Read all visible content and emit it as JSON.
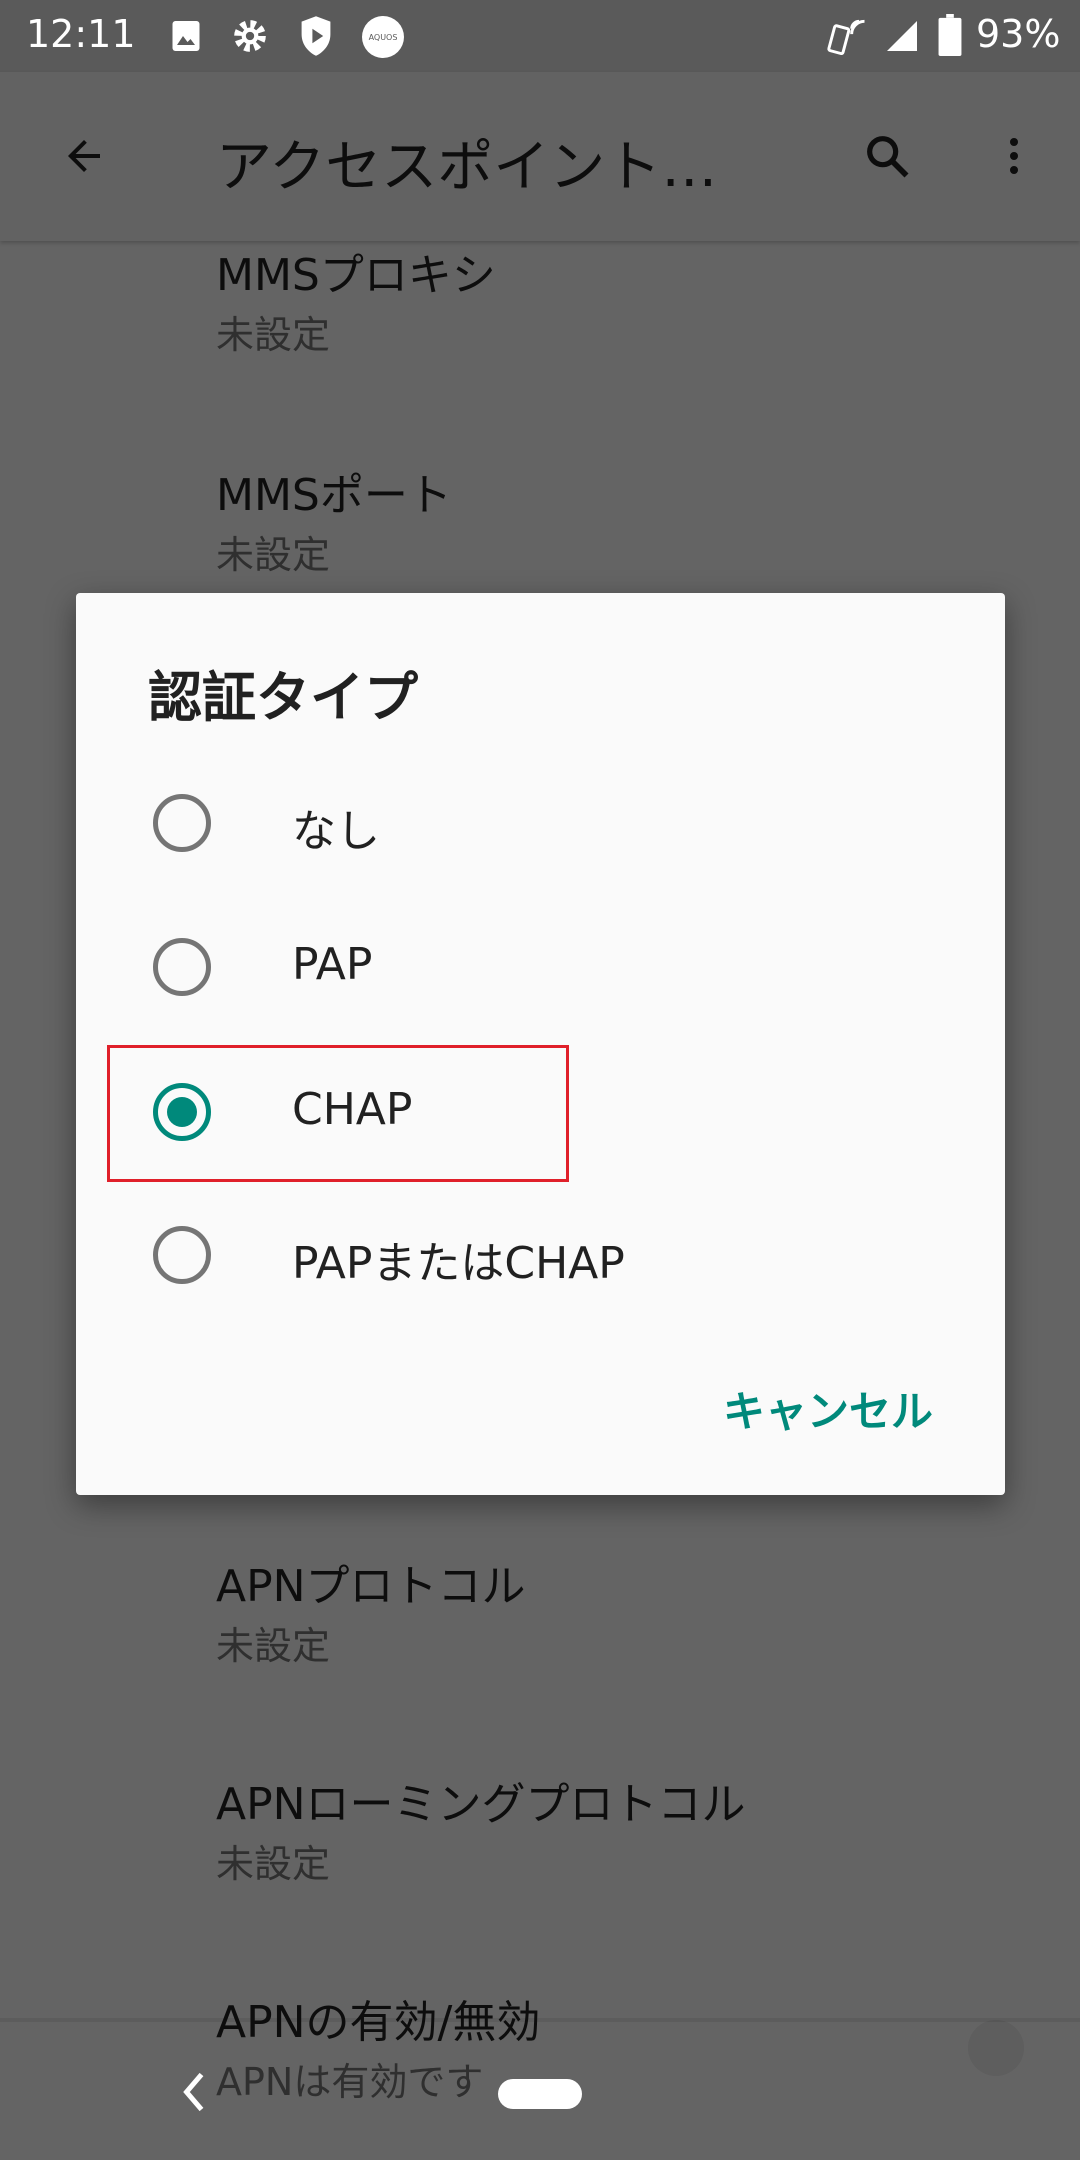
{
  "status_bar": {
    "time": "12:11",
    "battery": "93%",
    "icons": [
      "image-icon",
      "gear-icon",
      "shield-play-icon",
      "aquos-icon",
      "nfc-phone-icon",
      "signal-icon",
      "battery-icon"
    ],
    "aquos": "AQUOS"
  },
  "toolbar": {
    "title": "アクセスポイント…",
    "icons": [
      "back-arrow-icon",
      "search-icon",
      "more-vert-icon"
    ]
  },
  "list": [
    {
      "title": "MMSプロキシ",
      "summary": "未設定"
    },
    {
      "title": "MMSポート",
      "summary": "未設定"
    },
    {
      "title": "APNプロトコル",
      "summary": "未設定"
    },
    {
      "title": "APNローミングプロトコル",
      "summary": "未設定"
    },
    {
      "title": "APNの有効/無効",
      "summary": "APNは有効です"
    }
  ],
  "dialog": {
    "title": "認証タイプ",
    "options": [
      {
        "label": "なし",
        "selected": false
      },
      {
        "label": "PAP",
        "selected": false
      },
      {
        "label": "CHAP",
        "selected": true
      },
      {
        "label": "PAPまたはCHAP",
        "selected": false
      }
    ],
    "cancel": "キャンセル"
  },
  "colors": {
    "accent": "#00897b",
    "highlight_box": "#e0202a"
  }
}
